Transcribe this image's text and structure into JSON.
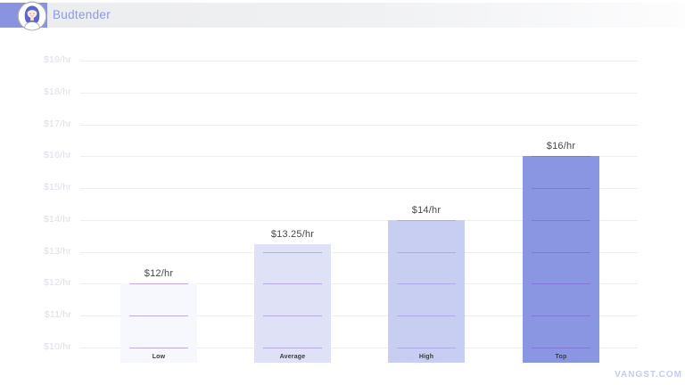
{
  "header": {
    "title": "Budtender"
  },
  "watermark": "VANGST.COM",
  "colors": {
    "accent": "#8a93e0",
    "title_text": "#8d99e2",
    "gridline": "#efeff2",
    "y_label": "#dcdee8",
    "value_label": "#48484c",
    "watermark": "#c6cbef"
  },
  "chart_data": {
    "type": "bar",
    "title": "Budtender",
    "unit": "$/hr",
    "categories": [
      "Low",
      "Average",
      "High",
      "Top"
    ],
    "values": [
      12,
      13.25,
      14,
      16
    ],
    "value_labels": [
      "$12/hr",
      "$13.25/hr",
      "$14/hr",
      "$16/hr"
    ],
    "xlabel": "",
    "ylabel": "",
    "ylim": [
      10,
      19
    ],
    "grid": true,
    "legend": false,
    "y_ticks": [
      {
        "value": 10,
        "label": "$10/hr"
      },
      {
        "value": 11,
        "label": "$11/hr"
      },
      {
        "value": 12,
        "label": "$12/hr"
      },
      {
        "value": 13,
        "label": "$13/hr"
      },
      {
        "value": 14,
        "label": "$14/hr"
      },
      {
        "value": 15,
        "label": "$15/hr"
      },
      {
        "value": 16,
        "label": "$16/hr"
      },
      {
        "value": 17,
        "label": "$17/hr"
      },
      {
        "value": 18,
        "label": "$18/hr"
      },
      {
        "value": 19,
        "label": "$19/hr"
      }
    ],
    "bar_colors": [
      "#f7f8fd",
      "#dfe2f7",
      "#c8cdf2",
      "#8b96e3"
    ],
    "bar_line_colors": [
      "#c4a9e2",
      "#b7a9e2",
      "#b0abe8",
      "#8277d6"
    ]
  }
}
